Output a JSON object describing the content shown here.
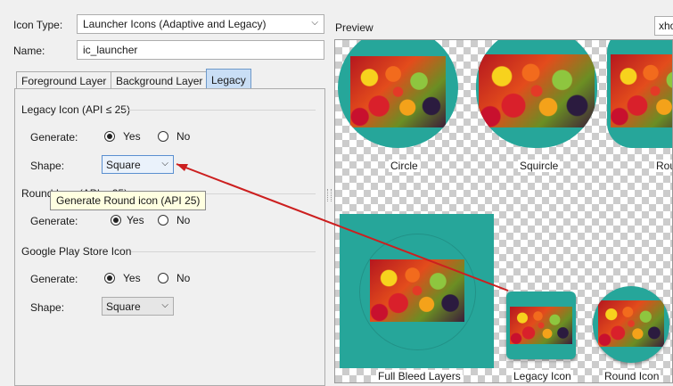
{
  "form": {
    "icon_type_label": "Icon Type:",
    "icon_type_value": "Launcher Icons (Adaptive and Legacy)",
    "name_label": "Name:",
    "name_value": "ic_launcher"
  },
  "tabs": [
    {
      "label": "Foreground Layer"
    },
    {
      "label": "Background Layer"
    },
    {
      "label": "Legacy"
    }
  ],
  "legacy": {
    "section_title": "Legacy Icon (API ≤ 25)",
    "generate_label": "Generate:",
    "yes_label": "Yes",
    "no_label": "No",
    "shape_label": "Shape:",
    "shape_value": "Square"
  },
  "round": {
    "section_title": "Round Icon (API = 25)",
    "generate_label": "Generate:",
    "yes_label": "Yes",
    "no_label": "No",
    "tooltip": "Generate Round icon (API 25)"
  },
  "play_store": {
    "section_title": "Google Play Store Icon",
    "generate_label": "Generate:",
    "yes_label": "Yes",
    "no_label": "No",
    "shape_label": "Shape:",
    "shape_value": "Square"
  },
  "preview": {
    "title": "Preview",
    "density_value": "xho",
    "labels": {
      "circle": "Circle",
      "squircle": "Squircle",
      "rounded": "Rounded",
      "full_bleed": "Full Bleed Layers",
      "legacy_icon": "Legacy Icon",
      "round_icon": "Round Icon"
    },
    "background_color": "#26a69a"
  },
  "annotation": {
    "arrow_color": "#cc1f1f"
  },
  "icons": {
    "dropdown": "chevron-down-icon"
  }
}
